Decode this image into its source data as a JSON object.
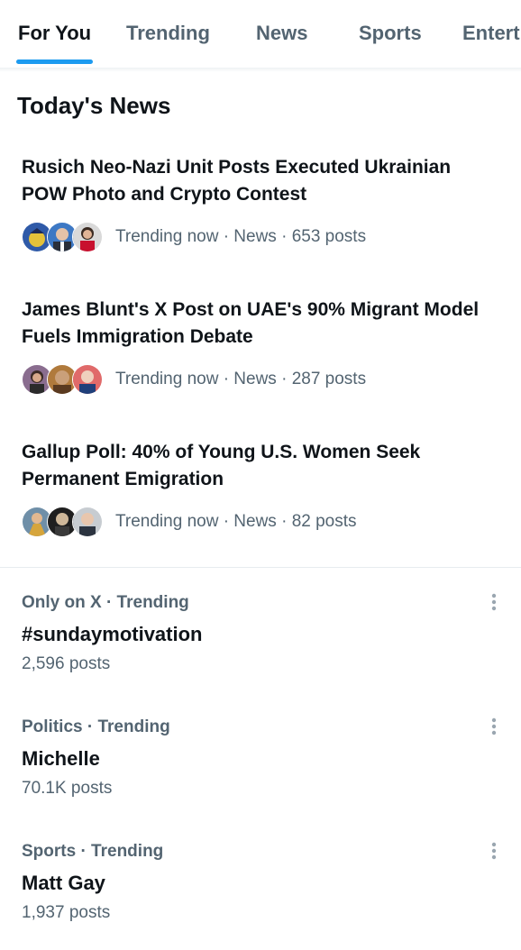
{
  "tabs": [
    {
      "label": "For You",
      "active": true
    },
    {
      "label": "Trending",
      "active": false
    },
    {
      "label": "News",
      "active": false
    },
    {
      "label": "Sports",
      "active": false
    },
    {
      "label": "Entert",
      "active": false
    }
  ],
  "section": {
    "title": "Today's News"
  },
  "news": [
    {
      "headline": "Rusich Neo-Nazi Unit Posts Executed Ukrainian POW Photo and Crypto Contest",
      "meta": "Trending now · News · 653 posts"
    },
    {
      "headline": "James Blunt's X Post on UAE's 90% Migrant Model Fuels Immigration Debate",
      "meta": "Trending now · News · 287 posts"
    },
    {
      "headline": "Gallup Poll: 40% of Young U.S. Women Seek Permanent Emigration",
      "meta": "Trending now · News · 82 posts"
    }
  ],
  "trends": [
    {
      "context": "Only on X · Trending",
      "name": "#sundaymotivation",
      "count": "2,596 posts"
    },
    {
      "context": "Politics · Trending",
      "name": "Michelle",
      "count": "70.1K posts"
    },
    {
      "context": "Sports · Trending",
      "name": "Matt Gay",
      "count": "1,937 posts"
    }
  ],
  "icons": {
    "more": "more-vertical-icon",
    "avatar": "avatar-thumbnail"
  },
  "colors": {
    "accent": "#1d9bf0",
    "text_primary": "#0f1419",
    "text_secondary": "#536471",
    "divider": "#eff3f4"
  }
}
